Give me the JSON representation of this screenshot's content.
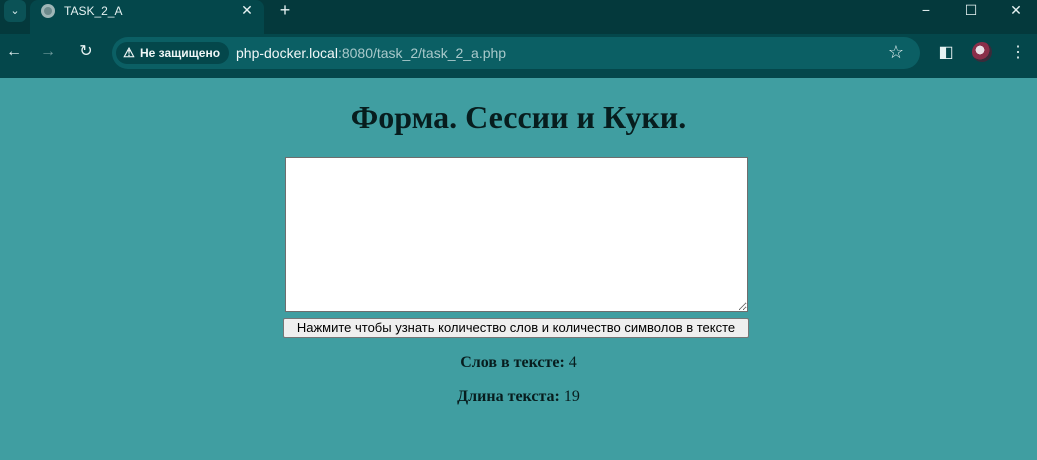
{
  "browser": {
    "tab_title": "TASK_2_A",
    "security_label": "Не защищено",
    "url_host": "php-docker.local",
    "url_rest": ":8080/task_2/task_2_a.php"
  },
  "page": {
    "title": "Форма. Сессии и Куки.",
    "textarea_value": "",
    "submit_label": "Нажмите чтобы узнать количество слов и количество символов в тексте",
    "words_label": "Слов в тексте:",
    "words_value": "4",
    "length_label": "Длина текста:",
    "length_value": "19"
  }
}
